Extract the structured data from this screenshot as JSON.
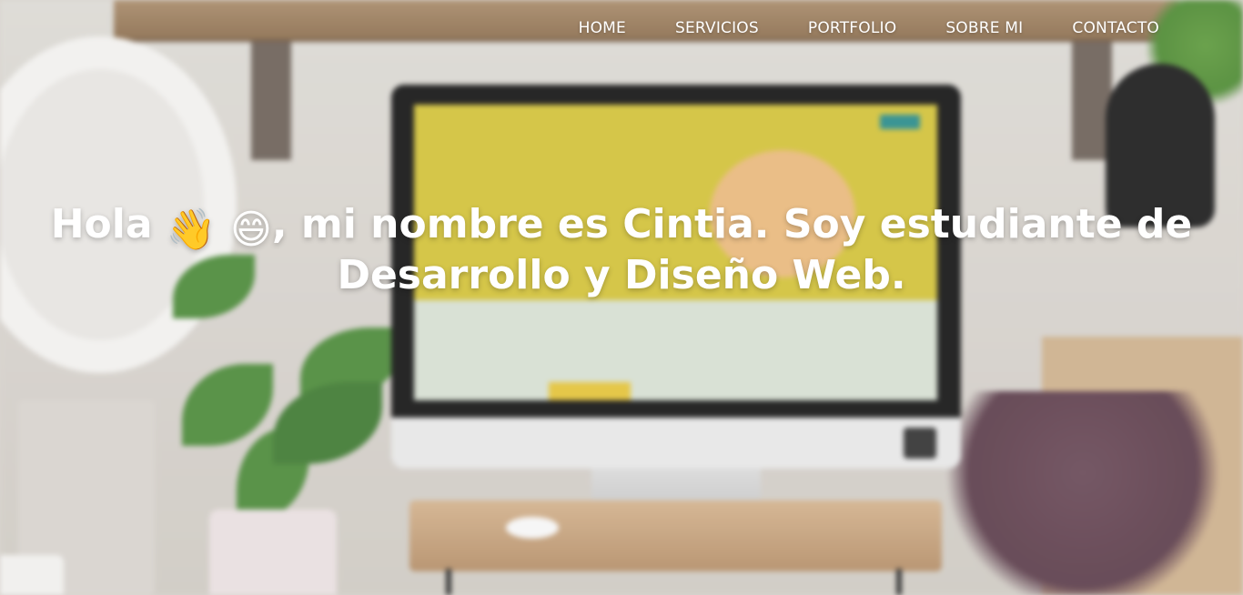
{
  "nav": {
    "items": [
      {
        "label": "HOME"
      },
      {
        "label": "SERVICIOS"
      },
      {
        "label": "PORTFOLIO"
      },
      {
        "label": "SOBRE MI"
      },
      {
        "label": "CONTACTO"
      }
    ]
  },
  "hero": {
    "greeting": "Hola",
    "emoji_wave": "👋",
    "emoji_smile": "😄",
    "text": ", mi nombre es Cintia. Soy estudiante de Desarrollo y Diseño Web."
  },
  "colors": {
    "text": "#ffffff",
    "screen_yellow": "#d2c23a"
  },
  "icons": {
    "wave": "waving-hand-icon",
    "smile": "grinning-face-icon"
  }
}
